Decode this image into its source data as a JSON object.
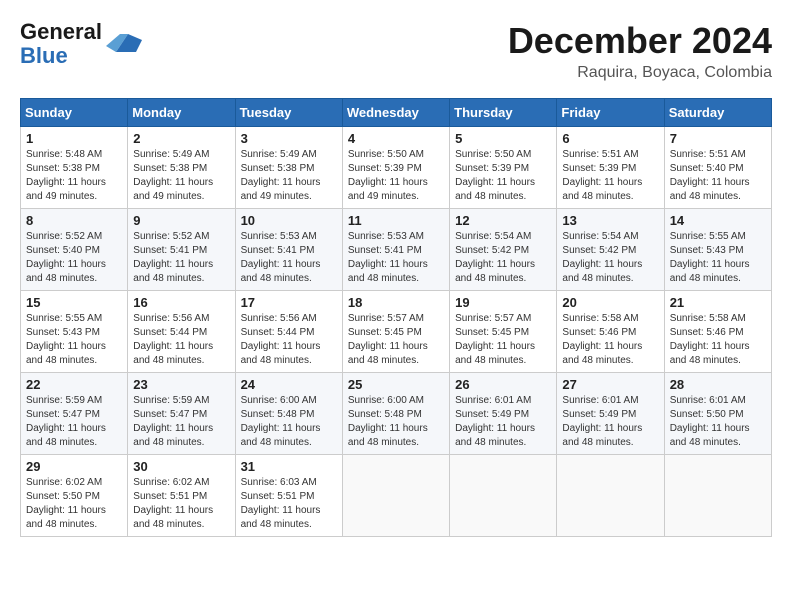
{
  "header": {
    "logo_line1": "General",
    "logo_line2": "Blue",
    "month_title": "December 2024",
    "location": "Raquira, Boyaca, Colombia"
  },
  "weekdays": [
    "Sunday",
    "Monday",
    "Tuesday",
    "Wednesday",
    "Thursday",
    "Friday",
    "Saturday"
  ],
  "weeks": [
    [
      {
        "day": "1",
        "sunrise": "5:48 AM",
        "sunset": "5:38 PM",
        "daylight": "11 hours and 49 minutes."
      },
      {
        "day": "2",
        "sunrise": "5:49 AM",
        "sunset": "5:38 PM",
        "daylight": "11 hours and 49 minutes."
      },
      {
        "day": "3",
        "sunrise": "5:49 AM",
        "sunset": "5:38 PM",
        "daylight": "11 hours and 49 minutes."
      },
      {
        "day": "4",
        "sunrise": "5:50 AM",
        "sunset": "5:39 PM",
        "daylight": "11 hours and 49 minutes."
      },
      {
        "day": "5",
        "sunrise": "5:50 AM",
        "sunset": "5:39 PM",
        "daylight": "11 hours and 48 minutes."
      },
      {
        "day": "6",
        "sunrise": "5:51 AM",
        "sunset": "5:39 PM",
        "daylight": "11 hours and 48 minutes."
      },
      {
        "day": "7",
        "sunrise": "5:51 AM",
        "sunset": "5:40 PM",
        "daylight": "11 hours and 48 minutes."
      }
    ],
    [
      {
        "day": "8",
        "sunrise": "5:52 AM",
        "sunset": "5:40 PM",
        "daylight": "11 hours and 48 minutes."
      },
      {
        "day": "9",
        "sunrise": "5:52 AM",
        "sunset": "5:41 PM",
        "daylight": "11 hours and 48 minutes."
      },
      {
        "day": "10",
        "sunrise": "5:53 AM",
        "sunset": "5:41 PM",
        "daylight": "11 hours and 48 minutes."
      },
      {
        "day": "11",
        "sunrise": "5:53 AM",
        "sunset": "5:41 PM",
        "daylight": "11 hours and 48 minutes."
      },
      {
        "day": "12",
        "sunrise": "5:54 AM",
        "sunset": "5:42 PM",
        "daylight": "11 hours and 48 minutes."
      },
      {
        "day": "13",
        "sunrise": "5:54 AM",
        "sunset": "5:42 PM",
        "daylight": "11 hours and 48 minutes."
      },
      {
        "day": "14",
        "sunrise": "5:55 AM",
        "sunset": "5:43 PM",
        "daylight": "11 hours and 48 minutes."
      }
    ],
    [
      {
        "day": "15",
        "sunrise": "5:55 AM",
        "sunset": "5:43 PM",
        "daylight": "11 hours and 48 minutes."
      },
      {
        "day": "16",
        "sunrise": "5:56 AM",
        "sunset": "5:44 PM",
        "daylight": "11 hours and 48 minutes."
      },
      {
        "day": "17",
        "sunrise": "5:56 AM",
        "sunset": "5:44 PM",
        "daylight": "11 hours and 48 minutes."
      },
      {
        "day": "18",
        "sunrise": "5:57 AM",
        "sunset": "5:45 PM",
        "daylight": "11 hours and 48 minutes."
      },
      {
        "day": "19",
        "sunrise": "5:57 AM",
        "sunset": "5:45 PM",
        "daylight": "11 hours and 48 minutes."
      },
      {
        "day": "20",
        "sunrise": "5:58 AM",
        "sunset": "5:46 PM",
        "daylight": "11 hours and 48 minutes."
      },
      {
        "day": "21",
        "sunrise": "5:58 AM",
        "sunset": "5:46 PM",
        "daylight": "11 hours and 48 minutes."
      }
    ],
    [
      {
        "day": "22",
        "sunrise": "5:59 AM",
        "sunset": "5:47 PM",
        "daylight": "11 hours and 48 minutes."
      },
      {
        "day": "23",
        "sunrise": "5:59 AM",
        "sunset": "5:47 PM",
        "daylight": "11 hours and 48 minutes."
      },
      {
        "day": "24",
        "sunrise": "6:00 AM",
        "sunset": "5:48 PM",
        "daylight": "11 hours and 48 minutes."
      },
      {
        "day": "25",
        "sunrise": "6:00 AM",
        "sunset": "5:48 PM",
        "daylight": "11 hours and 48 minutes."
      },
      {
        "day": "26",
        "sunrise": "6:01 AM",
        "sunset": "5:49 PM",
        "daylight": "11 hours and 48 minutes."
      },
      {
        "day": "27",
        "sunrise": "6:01 AM",
        "sunset": "5:49 PM",
        "daylight": "11 hours and 48 minutes."
      },
      {
        "day": "28",
        "sunrise": "6:01 AM",
        "sunset": "5:50 PM",
        "daylight": "11 hours and 48 minutes."
      }
    ],
    [
      {
        "day": "29",
        "sunrise": "6:02 AM",
        "sunset": "5:50 PM",
        "daylight": "11 hours and 48 minutes."
      },
      {
        "day": "30",
        "sunrise": "6:02 AM",
        "sunset": "5:51 PM",
        "daylight": "11 hours and 48 minutes."
      },
      {
        "day": "31",
        "sunrise": "6:03 AM",
        "sunset": "5:51 PM",
        "daylight": "11 hours and 48 minutes."
      },
      null,
      null,
      null,
      null
    ]
  ],
  "labels": {
    "sunrise_prefix": "Sunrise: ",
    "sunset_prefix": "Sunset: ",
    "daylight_prefix": "Daylight: "
  }
}
